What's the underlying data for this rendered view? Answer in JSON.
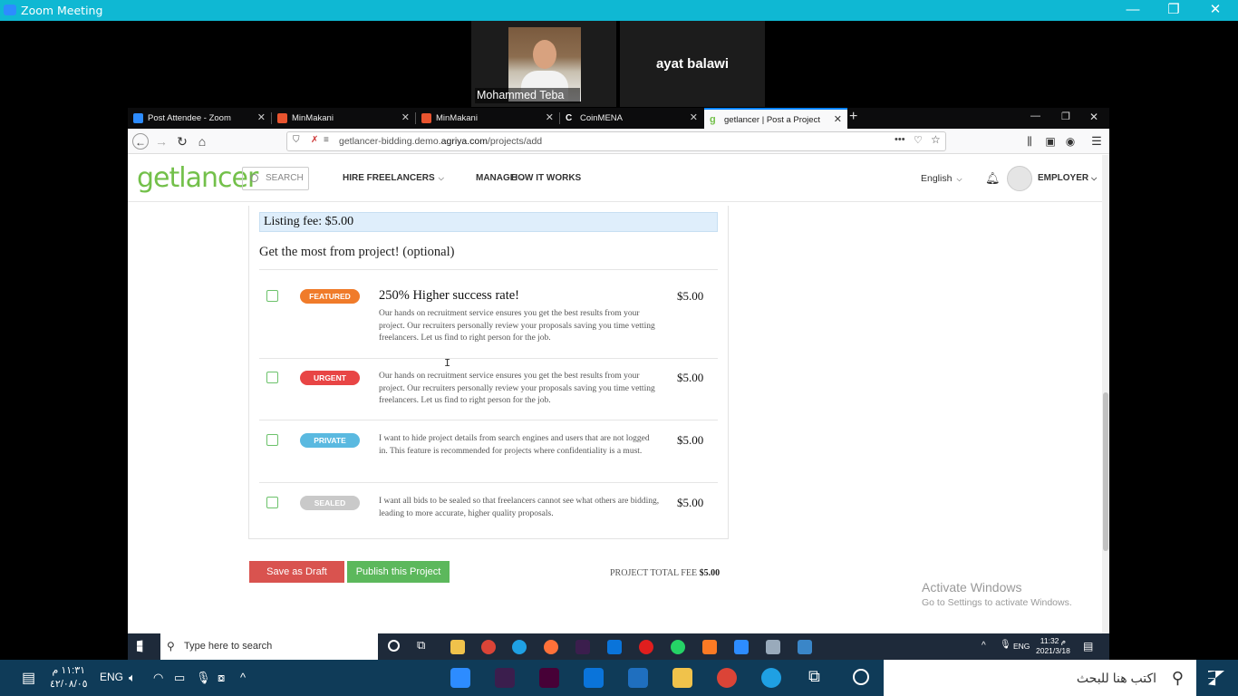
{
  "zoom": {
    "title": "Zoom Meeting",
    "controls": {
      "minimize": "—",
      "restore": "❐",
      "close": "✕"
    },
    "participants": [
      {
        "name": "Mohammed Teba"
      },
      {
        "name": "ayat balawi"
      }
    ]
  },
  "browser": {
    "tabs": [
      {
        "title": "Post Attendee - Zoom",
        "icon_color": "#2d8cff"
      },
      {
        "title": "MinMakani",
        "icon_color": "#e8542f"
      },
      {
        "title": "MinMakani",
        "icon_color": "#e8542f"
      },
      {
        "title": "CoinMENA",
        "icon_color": "#ffffff"
      },
      {
        "title": "getlancer | Post a Project",
        "icon_color": "#73c04a",
        "active": true
      }
    ],
    "new_tab": "+",
    "url_prefix": "getlancer-bidding.demo.",
    "url_domain": "agriya.com",
    "url_path": "/projects/add"
  },
  "site": {
    "logo": "getlancer",
    "search_placeholder": "SEARCH",
    "menu": {
      "hire": "HIRE FREELANCERS",
      "manage": "MANAGE",
      "how": "HOW IT WORKS"
    },
    "language": "English",
    "user_role": "EMPLOYER"
  },
  "page": {
    "listing_fee": "Listing fee: $5.00",
    "upsell_title": "Get the most from project! (optional)",
    "options": [
      {
        "badge": "FEATURED",
        "badge_color": "#f07b2a",
        "title": "250% Higher success rate!",
        "description": "Our hands on recruitment service ensures you get the best results from your project. Our recruiters personally review your proposals saving you time vetting freelancers. Let us find to right person for the job.",
        "price": "$5.00"
      },
      {
        "badge": "URGENT",
        "badge_color": "#e84545",
        "title": "",
        "description": "Our hands on recruitment service ensures you get the best results from your project. Our recruiters personally review your proposals saving you time vetting freelancers. Let us find to right person for the job.",
        "price": "$5.00"
      },
      {
        "badge": "PRIVATE",
        "badge_color": "#5ab9e0",
        "title": "",
        "description": "I want to hide project details from search engines and users that are not logged in. This feature is recommended for projects where confidentiality is a must.",
        "price": "$5.00"
      },
      {
        "badge": "SEALED",
        "badge_color": "#c9c9c9",
        "title": "",
        "description": "I want all bids to be sealed so that freelancers cannot see what others are bidding, leading to more accurate, higher quality proposals.",
        "price": "$5.00"
      }
    ],
    "save_draft": "Save as Draft",
    "publish": "Publish this Project",
    "total_label": "PROJECT TOTAL FEE",
    "total_value": "$5.00"
  },
  "watermark": {
    "line1": "Activate Windows",
    "line2": "Go to Settings to activate Windows."
  },
  "remote_taskbar": {
    "search": "Type here to search",
    "lang": "ENG",
    "time": "11:32 م",
    "date": "2021/3/18"
  },
  "local_taskbar": {
    "search": "اكتب هنا للبحث",
    "lang": "ENG",
    "time": "١١:٣١ م",
    "date": "٤٢/٠٨/٠٥"
  }
}
